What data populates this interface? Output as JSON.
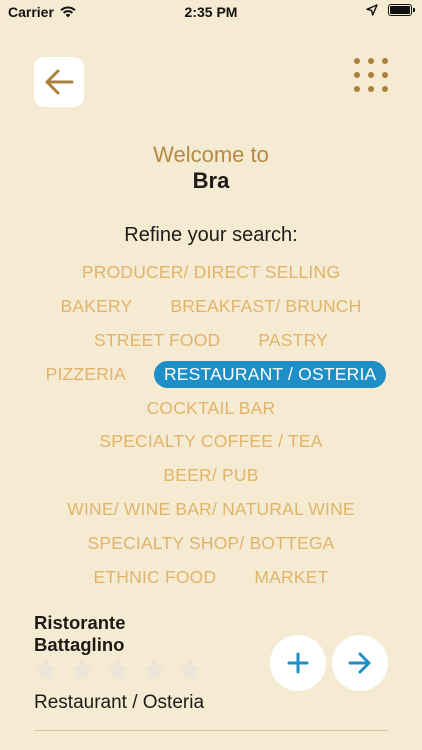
{
  "status_bar": {
    "carrier": "Carrier",
    "time": "2:35 PM"
  },
  "header": {
    "welcome": "Welcome to",
    "city": "Bra"
  },
  "filters": {
    "title": "Refine your search:",
    "rows": [
      [
        {
          "label": "PRODUCER/ DIRECT SELLING",
          "selected": false
        }
      ],
      [
        {
          "label": "BAKERY",
          "selected": false
        },
        {
          "label": "BREAKFAST/ BRUNCH",
          "selected": false
        }
      ],
      [
        {
          "label": "STREET FOOD",
          "selected": false
        },
        {
          "label": "PASTRY",
          "selected": false
        }
      ],
      [
        {
          "label": "PIZZERIA",
          "selected": false
        },
        {
          "label": "RESTAURANT / OSTERIA",
          "selected": true
        }
      ],
      [
        {
          "label": "COCKTAIL BAR",
          "selected": false
        }
      ],
      [
        {
          "label": "SPECIALTY COFFEE / TEA",
          "selected": false
        }
      ],
      [
        {
          "label": "BEER/ PUB",
          "selected": false
        }
      ],
      [
        {
          "label": "WINE/ WINE BAR/ NATURAL WINE",
          "selected": false
        }
      ],
      [
        {
          "label": "SPECIALTY SHOP/ BOTTEGA",
          "selected": false
        }
      ],
      [
        {
          "label": "ETHNIC FOOD",
          "selected": false
        },
        {
          "label": "MARKET",
          "selected": false
        }
      ]
    ]
  },
  "result": {
    "name": "Ristorante Battaglino",
    "rating": 0,
    "max_rating": 5,
    "category": "Restaurant / Osteria"
  },
  "colors": {
    "background": "#f5ead2",
    "accent_gold": "#b58a44",
    "tag_text": "#e2b46a",
    "selected_tag": "#1e8fc6",
    "action_blue": "#1e8fc6",
    "star_empty": "#ebe4d8"
  },
  "icons": {
    "back": "arrow-left-icon",
    "menu": "grid-dots-icon",
    "add": "plus-icon",
    "go": "arrow-right-icon",
    "star": "star-icon"
  }
}
